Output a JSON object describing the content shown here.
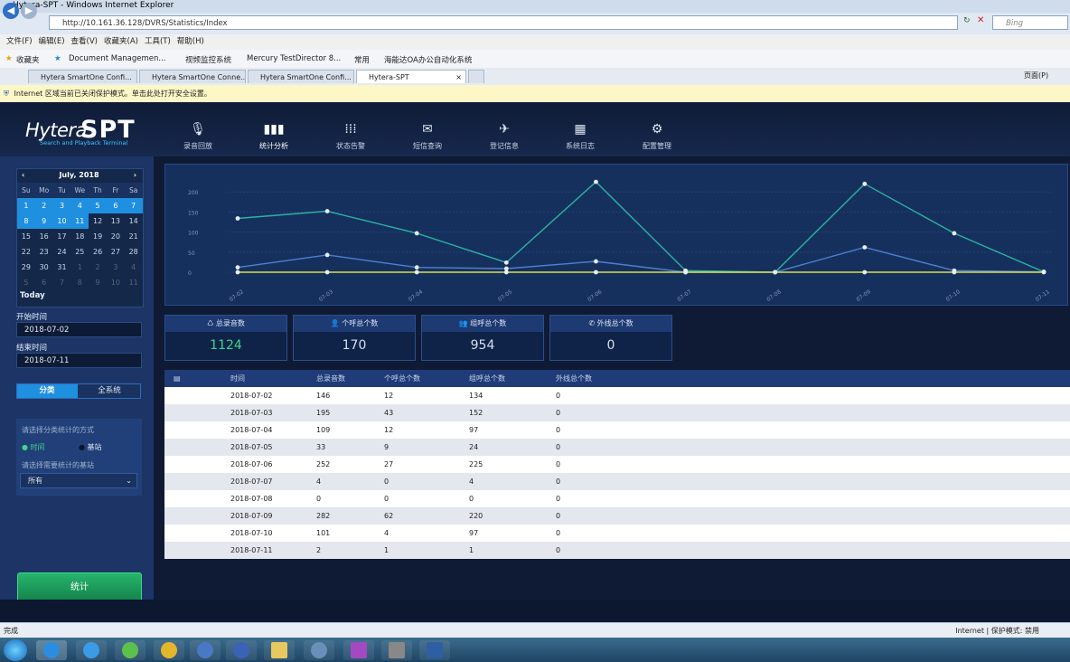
{
  "window": {
    "title": "Hytera-SPT - Windows Internet Explorer",
    "address": "http://10.161.36.128/DVRS/Statistics/Index",
    "search_placeholder": "Bing"
  },
  "menu": [
    "文件(F)",
    "编辑(E)",
    "查看(V)",
    "收藏夹(A)",
    "工具(T)",
    "帮助(H)"
  ],
  "favorites": {
    "label": "收藏夹",
    "items": [
      "Document Managemen...",
      "视频监控系统",
      "Mercury TestDirector 8...",
      "常用",
      "海能达OA办公自动化系统"
    ]
  },
  "tabs": [
    "Hytera SmartOne Confi...",
    "Hytera SmartOne Conne...",
    "Hytera SmartOne Confi...",
    "Hytera-SPT"
  ],
  "tab_tools": {
    "page_menu": "页面(P)"
  },
  "infobar": "Internet 区域当前已关闭保护模式。单击此处打开安全设置。",
  "app": {
    "logo_main": "Hytera",
    "logo_accent": "SPT",
    "logo_sub": "Search and Playback Terminal",
    "nav": [
      "录音回放",
      "统计分析",
      "状态告警",
      "短信查询",
      "登记信息",
      "系统日志",
      "配置管理"
    ]
  },
  "calendar": {
    "month": "July, 2018",
    "weekdays": [
      "Su",
      "Mo",
      "Tu",
      "We",
      "Th",
      "Fr",
      "Sa"
    ],
    "weeks": [
      [
        "1",
        "2",
        "3",
        "4",
        "5",
        "6",
        "7"
      ],
      [
        "8",
        "9",
        "10",
        "11",
        "12",
        "13",
        "14"
      ],
      [
        "15",
        "16",
        "17",
        "18",
        "19",
        "20",
        "21"
      ],
      [
        "22",
        "23",
        "24",
        "25",
        "26",
        "27",
        "28"
      ],
      [
        "29",
        "30",
        "31",
        "1",
        "2",
        "3",
        "4"
      ],
      [
        "5",
        "6",
        "7",
        "8",
        "9",
        "10",
        "11"
      ]
    ],
    "today": "Today"
  },
  "sidebar": {
    "start_label": "开始时间",
    "start_value": "2018-07-02",
    "end_label": "结束时间",
    "end_value": "2018-07-11",
    "seg_classify": "分类",
    "seg_all": "全系统",
    "method_prompt": "请选择分类统计的方式",
    "radio_time": "时间",
    "radio_base": "基站",
    "base_prompt": "请选择需要统计的基站",
    "base_select": "所有",
    "calc_button": "统计"
  },
  "stats": [
    {
      "label": "总录音数",
      "value": "1124",
      "color": "#3fd68a"
    },
    {
      "label": "个呼总个数",
      "value": "170",
      "color": "#d6dfee"
    },
    {
      "label": "组呼总个数",
      "value": "954",
      "color": "#d6dfee"
    },
    {
      "label": "外线总个数",
      "value": "0",
      "color": "#d6dfee"
    }
  ],
  "table": {
    "headers": [
      "时间",
      "总录音数",
      "个呼总个数",
      "组呼总个数",
      "外线总个数"
    ],
    "rows": [
      [
        "2018-07-02",
        "146",
        "12",
        "134",
        "0"
      ],
      [
        "2018-07-03",
        "195",
        "43",
        "152",
        "0"
      ],
      [
        "2018-07-04",
        "109",
        "12",
        "97",
        "0"
      ],
      [
        "2018-07-05",
        "33",
        "9",
        "24",
        "0"
      ],
      [
        "2018-07-06",
        "252",
        "27",
        "225",
        "0"
      ],
      [
        "2018-07-07",
        "4",
        "0",
        "4",
        "0"
      ],
      [
        "2018-07-08",
        "0",
        "0",
        "0",
        "0"
      ],
      [
        "2018-07-09",
        "282",
        "62",
        "220",
        "0"
      ],
      [
        "2018-07-10",
        "101",
        "4",
        "97",
        "0"
      ],
      [
        "2018-07-11",
        "2",
        "1",
        "1",
        "0"
      ]
    ]
  },
  "chart_data": {
    "type": "line",
    "x": [
      "07-02",
      "07-03",
      "07-04",
      "07-05",
      "07-06",
      "07-07",
      "07-08",
      "07-09",
      "07-10",
      "07-11"
    ],
    "yticks": [
      "0",
      "50",
      "100",
      "150",
      "200"
    ],
    "ylim": [
      0,
      250
    ],
    "series": [
      {
        "values": [
          134,
          152,
          97,
          24,
          225,
          4,
          0,
          220,
          97,
          1
        ],
        "color": "#2bb3a0"
      },
      {
        "values": [
          12,
          43,
          12,
          9,
          27,
          0,
          0,
          62,
          4,
          1
        ],
        "color": "#4f7fd0"
      },
      {
        "values": [
          0,
          0,
          0,
          0,
          0,
          0,
          0,
          0,
          0,
          0
        ],
        "color": "#d9e04a"
      }
    ]
  },
  "statusbar": {
    "left": "完成",
    "right": "Internet | 保护模式: 禁用"
  }
}
